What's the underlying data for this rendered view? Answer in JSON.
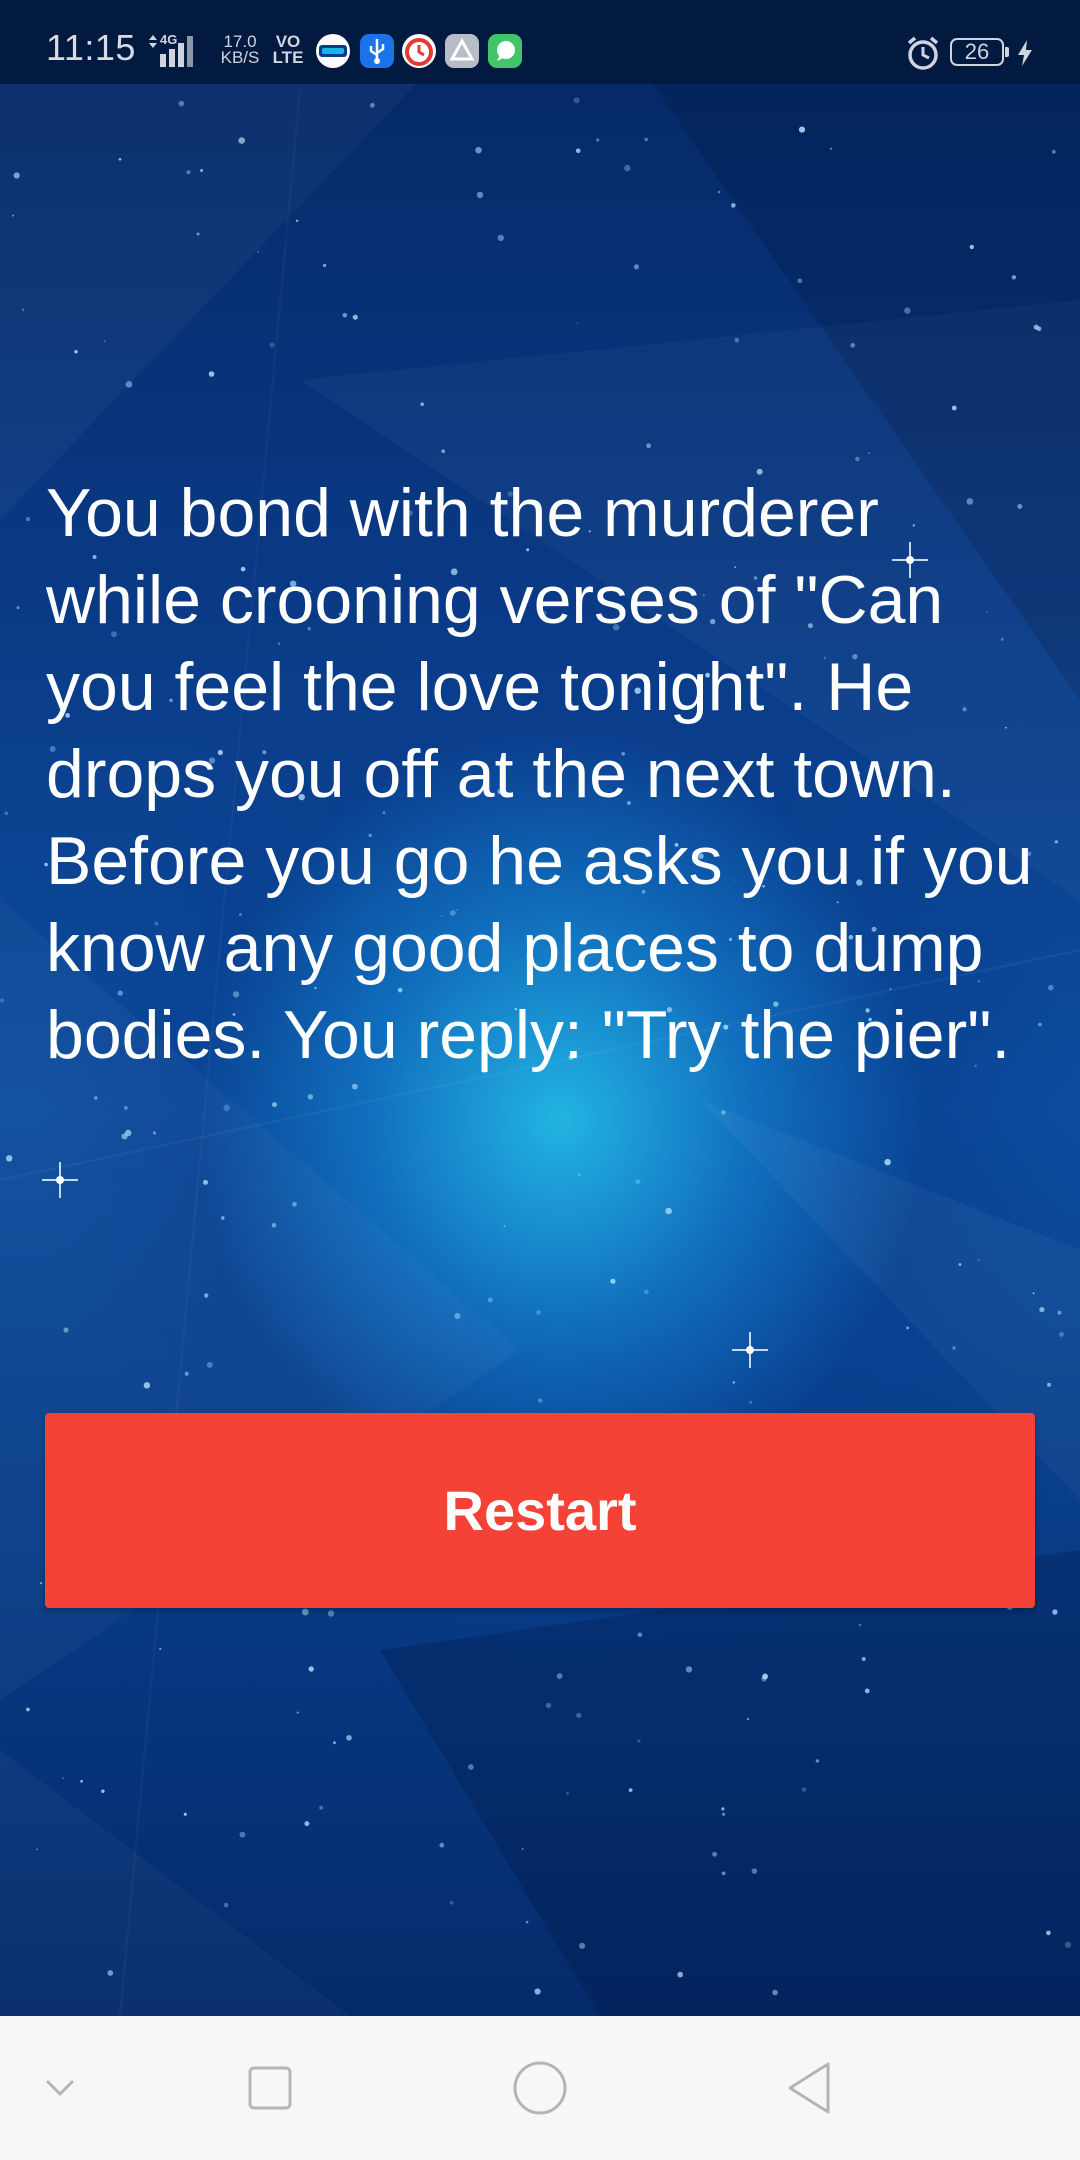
{
  "status_bar": {
    "time": "11:15",
    "network_type": "4G",
    "speed_value": "17.0",
    "speed_unit": "KB/S",
    "volte_top": "VO",
    "volte_bottom": "LTE",
    "battery_level": "26",
    "notification_icons": [
      "paytm-icon",
      "usb-icon",
      "alarm-clock-app-icon",
      "drive-icon",
      "chat-icon"
    ]
  },
  "story": {
    "text": "You bond with the murderer while crooning verses of \"Can you feel the love tonight\". He drops you off at the next town. Before you go he asks you if you know any good places to dump bodies. You reply: \"Try the pier\"."
  },
  "restart_button": {
    "label": "Restart",
    "color": "#f44336"
  },
  "nav_bar": {
    "items": [
      "chevron-down-icon",
      "recents-icon",
      "home-icon",
      "back-icon"
    ]
  },
  "colors": {
    "background_dark": "#052763",
    "background_glow": "#23b9e6",
    "text": "#ffffff",
    "nav_bar": "#f7f7f7"
  }
}
